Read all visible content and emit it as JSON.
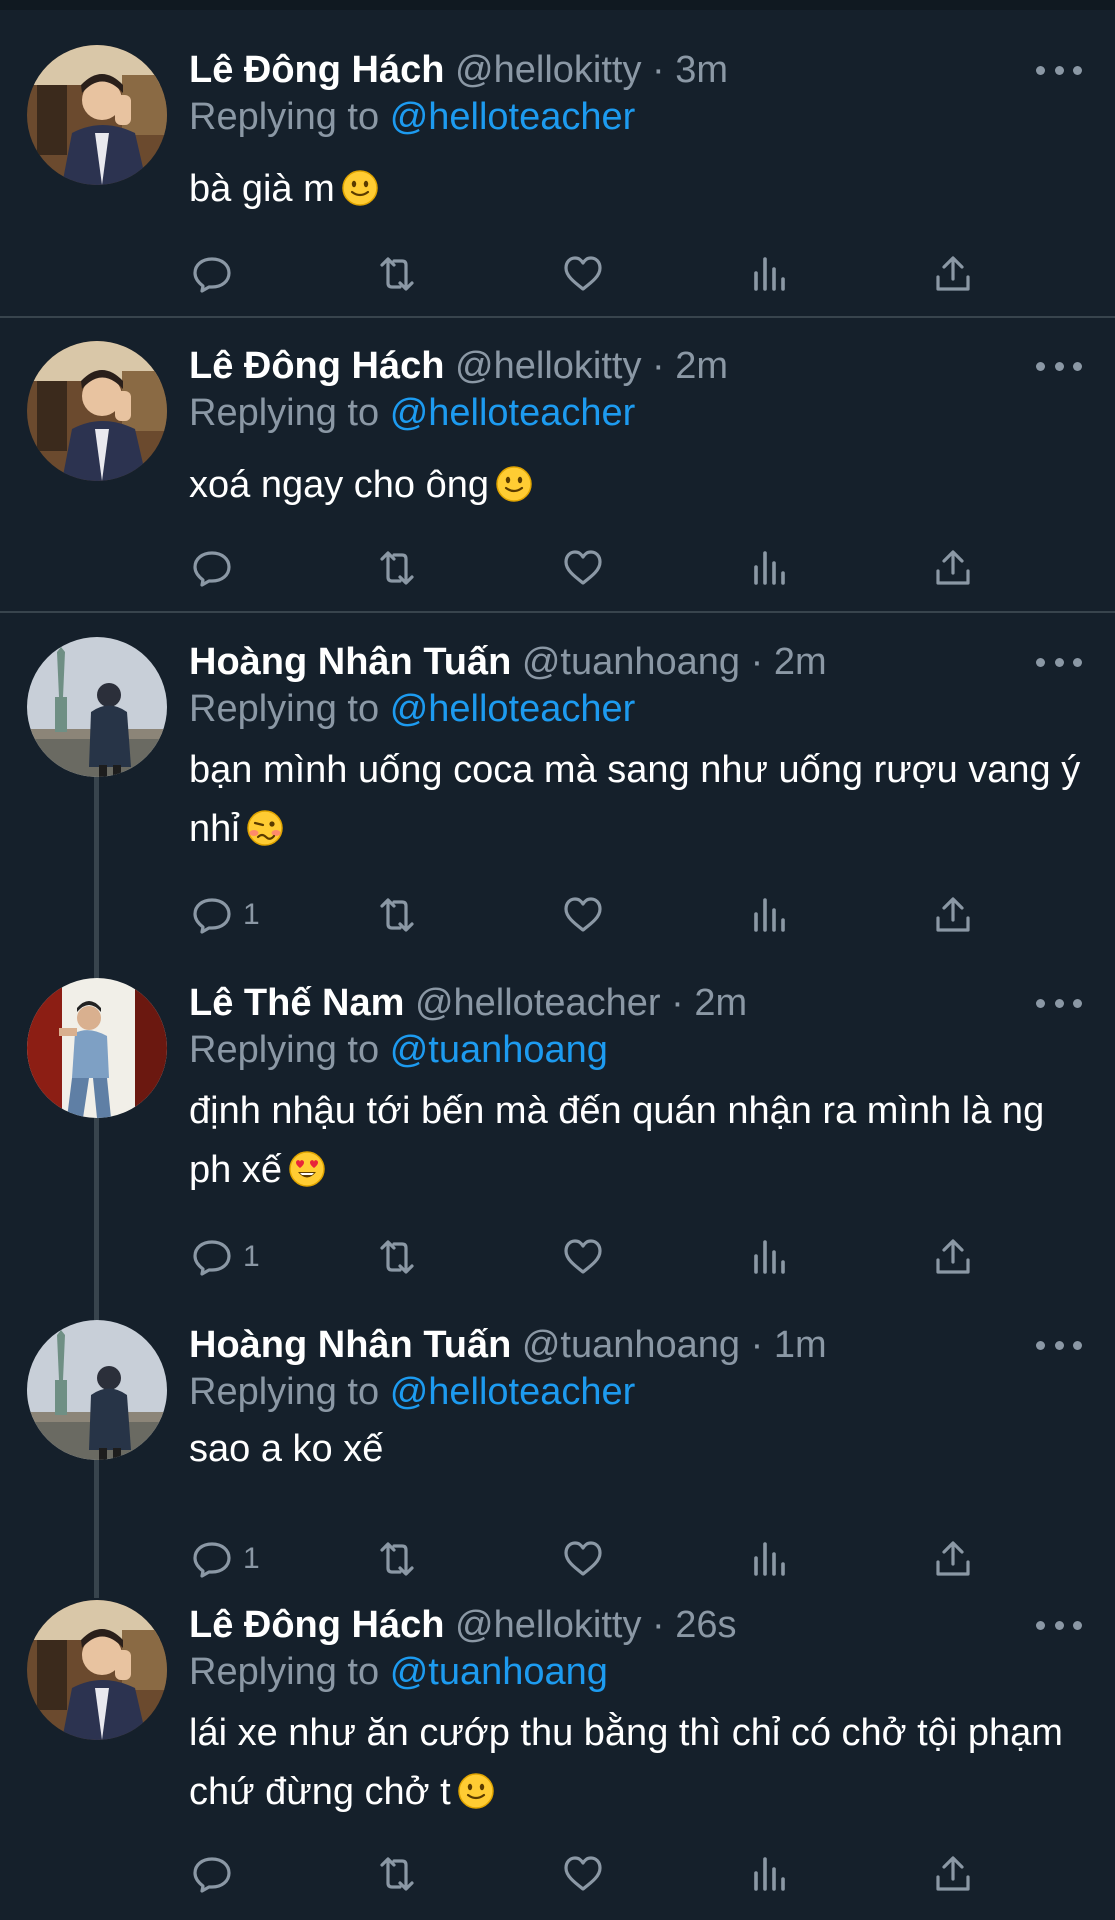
{
  "tweets": [
    {
      "name": "Lê Đông Hách",
      "handle": "@hellokitty",
      "time": "· 3m",
      "replying_label": "Replying to",
      "replying_to": "@helloteacher",
      "text": "bà già m",
      "emoji": "slightly-smiling-face",
      "reply_count": ""
    },
    {
      "name": "Lê Đông Hách",
      "handle": "@hellokitty",
      "time": "· 2m",
      "replying_label": "Replying to",
      "replying_to": "@helloteacher",
      "text": "xoá ngay cho ông",
      "emoji": "slightly-smiling-face",
      "reply_count": ""
    },
    {
      "name": "Hoàng Nhân Tuấn",
      "handle": "@tuanhoang",
      "time": "· 2m",
      "replying_label": "Replying to",
      "replying_to": "@helloteacher",
      "text": "bạn mình uống coca mà sang như uống rượu vang ý nhỉ",
      "emoji": "woozy-face",
      "reply_count": "1"
    },
    {
      "name": "Lê Thế Nam",
      "handle": "@helloteacher",
      "time": "· 2m",
      "replying_label": "Replying to",
      "replying_to": "@tuanhoang",
      "text": "định nhậu tới bến mà đến quán nhận ra mình là ng ph xế",
      "emoji": "heart-eyes-face",
      "reply_count": "1"
    },
    {
      "name": "Hoàng Nhân Tuấn",
      "handle": "@tuanhoang",
      "time": "· 1m",
      "replying_label": "Replying to",
      "replying_to": "@helloteacher",
      "text": "sao a ko xế",
      "emoji": "",
      "reply_count": "1"
    },
    {
      "name": "Lê Đông Hách",
      "handle": "@hellokitty",
      "time": "· 26s",
      "replying_label": "Replying to",
      "replying_to": "@tuanhoang",
      "text": "lái xe như ăn cướp thu bằng thì chỉ có chở tội phạm chứ đừng chở t",
      "emoji": "slightly-smiling-face",
      "reply_count": ""
    }
  ],
  "colors": {
    "background": "#15202b",
    "text": "#ffffff",
    "secondary": "#8b98a5",
    "link": "#1d9bf0",
    "divider": "#38444d"
  },
  "action_icons": [
    "reply-icon",
    "retweet-icon",
    "like-icon",
    "analytics-icon",
    "share-icon"
  ]
}
